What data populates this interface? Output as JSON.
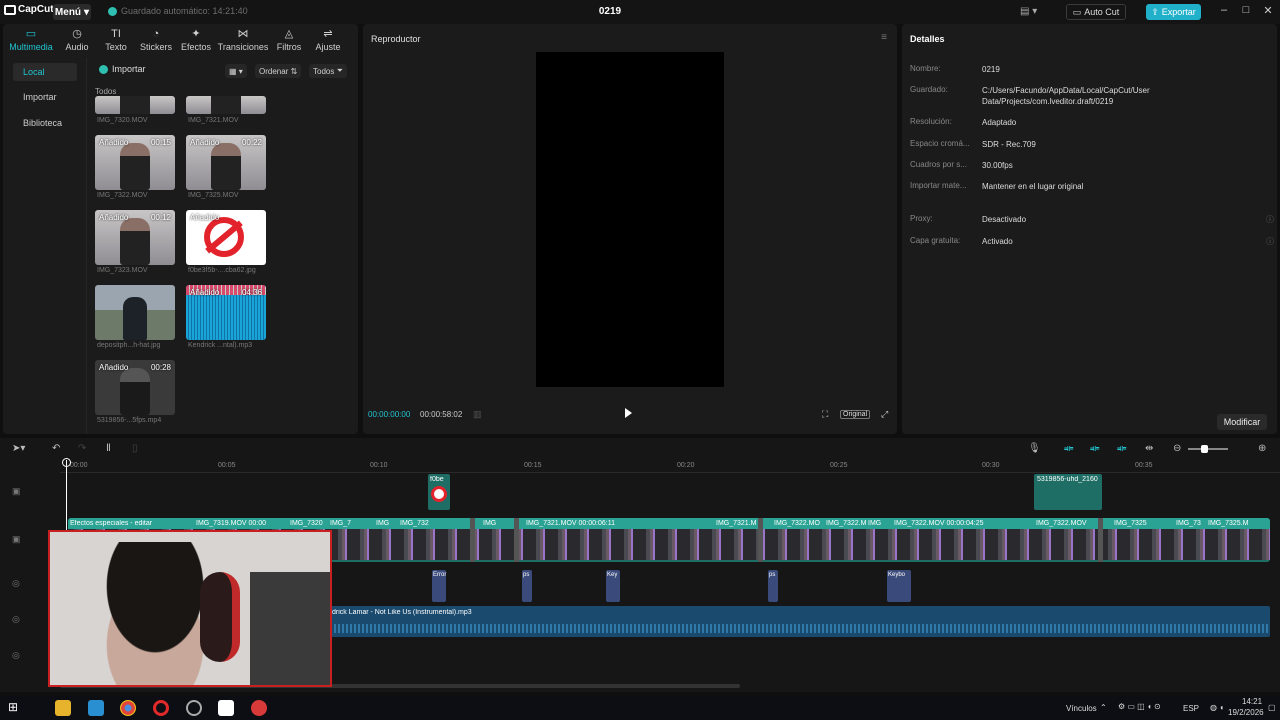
{
  "titlebar": {
    "app_name": "CapCut",
    "menu_label": "Menú",
    "autosave_text": "Guardado automático: 14:21:40",
    "project_title": "0219",
    "autocut_label": "Auto Cut",
    "export_label": "Exportar",
    "accent_color": "#21b0c9"
  },
  "media": {
    "tabs": [
      {
        "label": "Multimedia",
        "icon": "media-icon"
      },
      {
        "label": "Audio",
        "icon": "audio-icon"
      },
      {
        "label": "Texto",
        "icon": "text-icon"
      },
      {
        "label": "Stickers",
        "icon": "sticker-icon"
      },
      {
        "label": "Efectos",
        "icon": "effects-icon"
      },
      {
        "label": "Transiciones",
        "icon": "transition-icon"
      },
      {
        "label": "Filtros",
        "icon": "filter-icon"
      },
      {
        "label": "Ajuste",
        "icon": "adjust-icon"
      }
    ],
    "side_items": [
      "Local",
      "Importar",
      "Biblioteca"
    ],
    "import_label": "Importar",
    "sort_label": "Ordenar",
    "filter_label": "Todos",
    "section_label": "Todos",
    "items": [
      {
        "name": "IMG_7320.MOV",
        "tag": "",
        "duration": ""
      },
      {
        "name": "IMG_7321.MOV",
        "tag": "",
        "duration": ""
      },
      {
        "name": "IMG_7322.MOV",
        "tag": "Añadido",
        "duration": "00:15"
      },
      {
        "name": "IMG_7325.MOV",
        "tag": "Añadido",
        "duration": "00:22"
      },
      {
        "name": "IMG_7323.MOV",
        "tag": "Añadido",
        "duration": "00:12"
      },
      {
        "name": "f0be3f5b-....cba62.jpg",
        "tag": "Añadido",
        "duration": ""
      },
      {
        "name": "depositph...h-hat.jpg",
        "tag": "",
        "duration": ""
      },
      {
        "name": "Kendrick ...ntal).mp3",
        "tag": "Añadido",
        "duration": "04:36"
      },
      {
        "name": "5319856-...5fps.mp4",
        "tag": "Añadido",
        "duration": "00:28"
      }
    ]
  },
  "player": {
    "title": "Reproductor",
    "current_time": "00:00:00:00",
    "total_time": "00:00:58:02",
    "original_label": "Original"
  },
  "details": {
    "title": "Detalles",
    "rows": [
      {
        "key": "Nombre:",
        "value": "0219"
      },
      {
        "key": "Guardado:",
        "value": "C:/Users/Facundo/AppData/Local/CapCut/User Data/Projects/com.lveditor.draft/0219"
      },
      {
        "key": "Resolución:",
        "value": "Adaptado"
      },
      {
        "key": "Espacio cromá...",
        "value": "SDR - Rec.709"
      },
      {
        "key": "Cuadros por s...",
        "value": "30.00fps"
      },
      {
        "key": "Importar mate...",
        "value": "Mantener en el lugar original"
      },
      {
        "key": "Proxy:",
        "value": "Desactivado"
      },
      {
        "key": "Capa gratuita:",
        "value": "Activado"
      }
    ],
    "modify_label": "Modificar"
  },
  "timeline": {
    "ruler": [
      "00:00",
      "00:05",
      "00:10",
      "00:15",
      "00:20",
      "00:25",
      "00:30",
      "00:35"
    ],
    "main_clips": [
      "Efectos especiales - editar",
      "IMG_7319.MOV  00:00",
      "IMG_7320",
      "IMG_7",
      "IMG",
      "IMG_732",
      "IMG",
      "IMG_7321.MOV  00:00:06:11",
      "IMG_7321.M",
      "IMG_7322.MO",
      "IMG_7322.M",
      "IMG",
      "IMG_7322.MOV  00:00:04:25",
      "IMG_7322.MOV",
      "IMG_7325",
      "IMG_73",
      "IMG_7325.M"
    ],
    "overlay_top_label": "f0be",
    "overlay_right_label": "5319856-uhd_2160",
    "mini_clips": [
      "Error",
      "ps",
      "Key",
      "ps",
      "Keybo"
    ],
    "audio_label": "drick Lamar - Not Like Us (Instrumental).mp3"
  },
  "taskbar": {
    "links_label": "Vínculos",
    "lang": "ESP",
    "time": "14:21",
    "date": "19/2/2026"
  }
}
